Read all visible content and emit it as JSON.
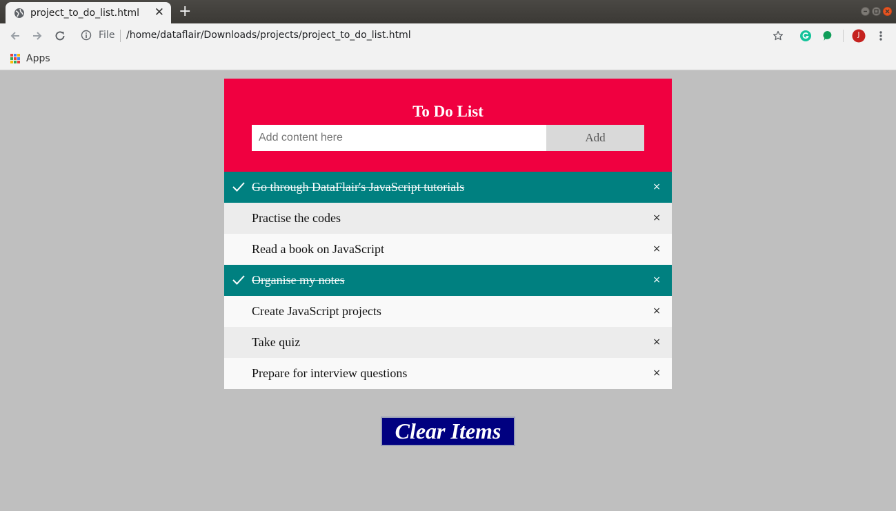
{
  "browser": {
    "tab_title": "project_to_do_list.html",
    "tab_close": "✕",
    "new_tab": "+",
    "omnibox_scheme": "File",
    "url": "/home/dataflair/Downloads/projects/project_to_do_list.html",
    "bookmarks": {
      "apps_label": "Apps"
    },
    "profile_initial": "J"
  },
  "todo": {
    "title": "To Do List",
    "input_placeholder": "Add content here",
    "add_label": "Add",
    "items": [
      {
        "text": "Go through DataFlair's JavaScript tutorials",
        "checked": true
      },
      {
        "text": "Practise the codes",
        "checked": false
      },
      {
        "text": "Read a book on JavaScript",
        "checked": false
      },
      {
        "text": "Organise my notes",
        "checked": true
      },
      {
        "text": "Create JavaScript projects",
        "checked": false
      },
      {
        "text": "Take quiz",
        "checked": false
      },
      {
        "text": "Prepare for interview questions",
        "checked": false
      }
    ],
    "close_glyph": "×",
    "clear_label": "Clear Items"
  },
  "colors": {
    "header": "#f00040",
    "checked_item": "#008080",
    "clear_button": "#000080",
    "page_background": "#bfbfbf"
  }
}
